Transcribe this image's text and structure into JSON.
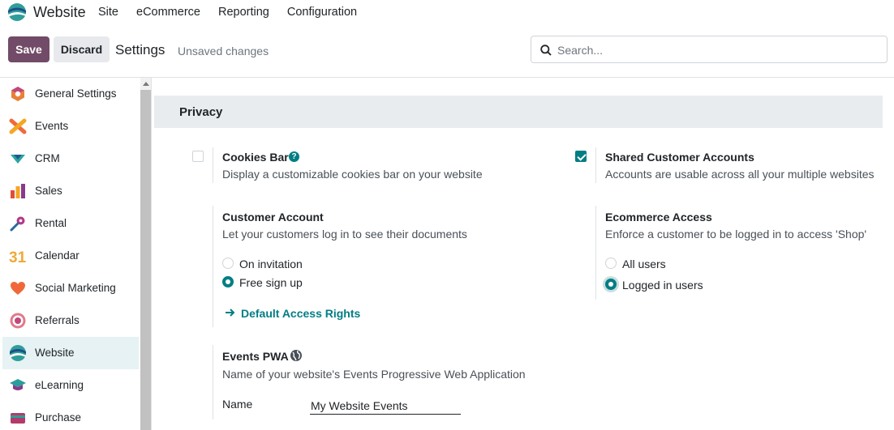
{
  "navbar": {
    "app_name": "Website",
    "menu": [
      "Site",
      "eCommerce",
      "Reporting",
      "Configuration"
    ]
  },
  "control": {
    "save_label": "Save",
    "discard_label": "Discard",
    "breadcrumb": "Settings",
    "status": "Unsaved changes",
    "search_placeholder": "Search..."
  },
  "sidebar": {
    "items": [
      {
        "label": "General Settings",
        "icon": "general-settings-icon"
      },
      {
        "label": "Events",
        "icon": "events-icon"
      },
      {
        "label": "CRM",
        "icon": "crm-icon"
      },
      {
        "label": "Sales",
        "icon": "sales-icon"
      },
      {
        "label": "Rental",
        "icon": "rental-icon"
      },
      {
        "label": "Calendar",
        "icon": "calendar-icon"
      },
      {
        "label": "Social Marketing",
        "icon": "social-marketing-icon"
      },
      {
        "label": "Referrals",
        "icon": "referrals-icon"
      },
      {
        "label": "Website",
        "icon": "website-icon"
      },
      {
        "label": "eLearning",
        "icon": "elearning-icon"
      },
      {
        "label": "Purchase",
        "icon": "purchase-icon"
      }
    ],
    "active": "Website",
    "calendar_glyph": "31"
  },
  "privacy": {
    "section_title": "Privacy",
    "cookies_bar": {
      "title": "Cookies Bar",
      "description": "Display a customizable cookies bar on your website",
      "checked": false
    },
    "shared_accounts": {
      "title": "Shared Customer Accounts",
      "description": "Accounts are usable across all your multiple websites",
      "checked": true
    },
    "customer_account": {
      "title": "Customer Account",
      "description": "Let your customers log in to see their documents",
      "options": [
        "On invitation",
        "Free sign up"
      ],
      "selected": "Free sign up",
      "link": "Default Access Rights"
    },
    "ecommerce_access": {
      "title": "Ecommerce Access",
      "description": "Enforce a customer to be logged in to access 'Shop'",
      "options": [
        "All users",
        "Logged in users"
      ],
      "selected": "Logged in users"
    },
    "events_pwa": {
      "title": "Events PWA",
      "description": "Name of your website's Events Progressive Web Application",
      "field_label": "Name",
      "field_value": "My Website Events"
    }
  },
  "colors": {
    "primary": "#714b67",
    "accent": "#017e84",
    "active_bg": "#e6f2f3",
    "section_bg": "#e9ecef"
  }
}
